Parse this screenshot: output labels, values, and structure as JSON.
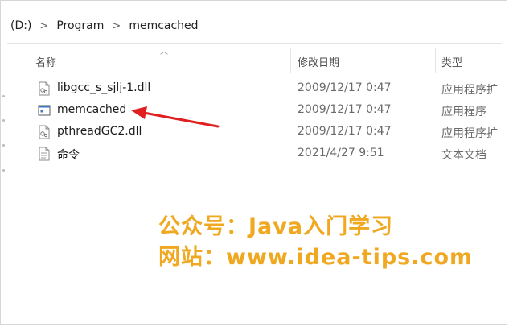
{
  "address_bar": {
    "crumbs": [
      "(D:)",
      "Program",
      "memcached"
    ]
  },
  "columns": {
    "name": "名称",
    "modified": "修改日期",
    "type": "类型"
  },
  "files": [
    {
      "name": "libgcc_s_sjlj-1.dll",
      "modified": "2009/12/17 0:47",
      "type": "应用程序扩",
      "icon": "dll-file-icon"
    },
    {
      "name": "memcached",
      "modified": "2009/12/17 0:47",
      "type": "应用程序",
      "icon": "exe-app-icon"
    },
    {
      "name": "pthreadGC2.dll",
      "modified": "2009/12/17 0:47",
      "type": "应用程序扩",
      "icon": "dll-file-icon"
    },
    {
      "name": "命令",
      "modified": "2021/4/27 9:51",
      "type": "文本文档",
      "icon": "text-file-icon"
    }
  ],
  "watermark": {
    "line1": "公众号：Java入门学习",
    "line2": "网站：www.idea-tips.com",
    "color": "#f0a820"
  },
  "annotation": {
    "arrow_color": "#e02020"
  }
}
